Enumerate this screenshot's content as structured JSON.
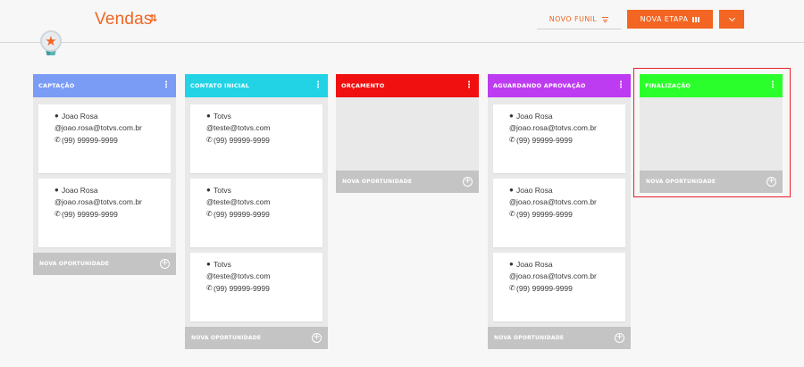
{
  "header": {
    "title": "Vendas",
    "title_icon": "sort-arrows-icon",
    "novo_funil_label": "NOVO FUNIL",
    "nova_etapa_label": "NOVA ETAPA"
  },
  "colors": {
    "accent": "#f26522",
    "captacao": "#7a9cf5",
    "contato_inicial": "#22d3e6",
    "orcamento": "#f01010",
    "aguardando_aprovacao": "#bd3bf0",
    "finalizacao": "#2bff2b",
    "highlight": "#e8202a"
  },
  "board": {
    "add_label": "NOVA OPORTUNIDADE",
    "columns": [
      {
        "title": "CAPTAÇÃO",
        "cards": [
          {
            "name": "Joao Rosa",
            "email": "joao.rosa@totvs.com.br",
            "phone": "(99) 99999-9999"
          },
          {
            "name": "Joao Rosa",
            "email": "joao.rosa@totvs.com.br",
            "phone": "(99) 99999-9999"
          }
        ]
      },
      {
        "title": "CONTATO INICIAL",
        "cards": [
          {
            "name": "Totvs",
            "email": "teste@totvs.com",
            "phone": "(99) 99999-9999"
          },
          {
            "name": "Totvs",
            "email": "teste@totvs.com",
            "phone": "(99) 99999-9999"
          },
          {
            "name": "Totvs",
            "email": "teste@totvs.com",
            "phone": "(99) 99999-9999"
          }
        ]
      },
      {
        "title": "ORÇAMENTO",
        "cards": []
      },
      {
        "title": "AGUARDANDO APROVAÇÃO",
        "cards": [
          {
            "name": "Joao Rosa",
            "email": "joao.rosa@totvs.com.br",
            "phone": "(99) 99999-9999"
          },
          {
            "name": "Joao Rosa",
            "email": "joao.rosa@totvs.com.br",
            "phone": "(99) 99999-9999"
          },
          {
            "name": "Joao Rosa",
            "email": "joao.rosa@totvs.com.br",
            "phone": "(99) 99999-9999"
          }
        ]
      },
      {
        "title": "FINALIZAÇÃO",
        "cards": []
      }
    ]
  }
}
